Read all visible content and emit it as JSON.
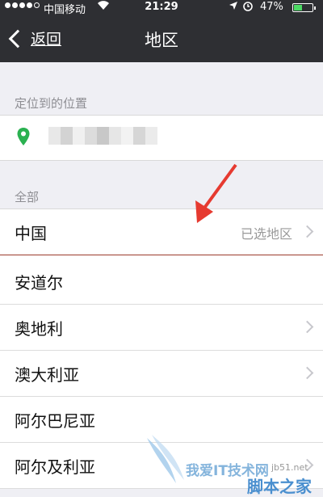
{
  "status_bar": {
    "carrier": "中国移动",
    "time": "21:29",
    "battery": "47%",
    "battery_level": 0.47
  },
  "nav": {
    "back_label": "返回",
    "title": "地区"
  },
  "location_section": {
    "header": "定位到的位置"
  },
  "all_section": {
    "header": "全部"
  },
  "regions": [
    {
      "name": "中国",
      "note": "已选地区",
      "chevron": true
    },
    {
      "name": "安道尔",
      "note": "",
      "chevron": false
    },
    {
      "name": "奥地利",
      "note": "",
      "chevron": true
    },
    {
      "name": "澳大利亚",
      "note": "",
      "chevron": true
    },
    {
      "name": "阿尔巴尼亚",
      "note": "",
      "chevron": false
    },
    {
      "name": "阿尔及利亚",
      "note": "",
      "chevron": true
    }
  ],
  "watermark": {
    "site": "jb51.net",
    "brand": "我爱IT技术网",
    "brand2": "脚本之家"
  },
  "colors": {
    "nav_bg": "#2e2f33",
    "page_bg": "#efeff4",
    "pin_green": "#2ab150",
    "annotation_red": "#e63a30"
  }
}
